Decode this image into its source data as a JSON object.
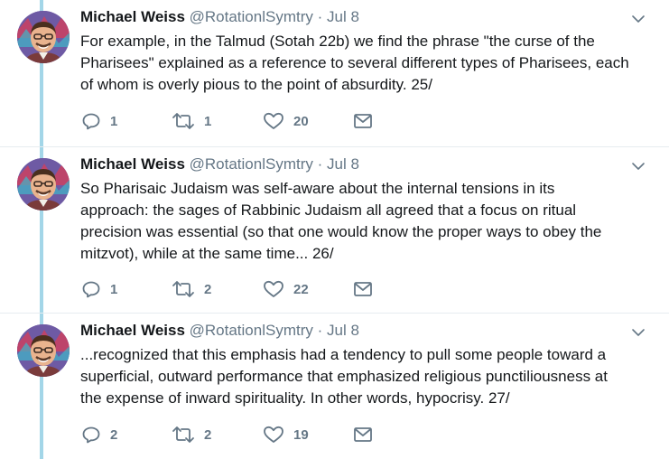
{
  "tweets": [
    {
      "name": "Michael Weiss",
      "handle": "@RotationlSymtry",
      "separator": "·",
      "date": "Jul 8",
      "lines": [
        "For example, in the Talmud (Sotah 22b) we find the phrase \"the curse of the",
        "Pharisees\" explained as a reference to several different types of Pharisees, each",
        "of whom is overly pious to the point of absurdity.  25/"
      ],
      "replies": "1",
      "retweets": "1",
      "likes": "20"
    },
    {
      "name": "Michael Weiss",
      "handle": "@RotationlSymtry",
      "separator": "·",
      "date": "Jul 8",
      "lines": [
        "So Pharisaic Judaism was self-aware about the internal tensions in its",
        "approach: the sages of Rabbinic Judaism all agreed that a focus on ritual",
        "precision was essential (so that one would know the proper ways to obey the",
        "mitzvot), while at the same time...  26/"
      ],
      "replies": "1",
      "retweets": "2",
      "likes": "22"
    },
    {
      "name": "Michael Weiss",
      "handle": "@RotationlSymtry",
      "separator": "·",
      "date": "Jul 8",
      "lines": [
        "...recognized that this emphasis had a tendency to pull some people toward a",
        "superficial, outward performance that emphasized religious punctiliousness at",
        "the expense of inward spirituality. In other words, hypocrisy.   27/"
      ],
      "replies": "2",
      "retweets": "2",
      "likes": "19"
    }
  ],
  "colors": {
    "thread_line": "#a3d6e8",
    "muted": "#657786",
    "text": "#14171a",
    "divider": "#e6ecf0"
  },
  "icons": {
    "reply": "reply-icon",
    "retweet": "retweet-icon",
    "like": "heart-icon",
    "message": "envelope-icon",
    "menu": "chevron-down-icon"
  }
}
